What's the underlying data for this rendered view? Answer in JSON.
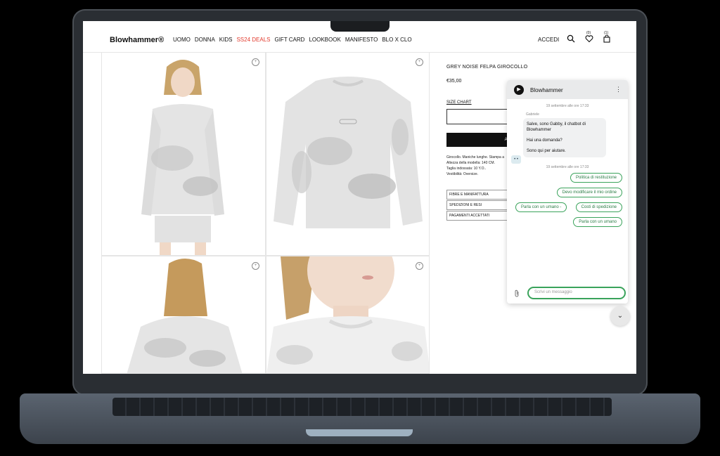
{
  "header": {
    "brand": "Blowhammer®",
    "nav": [
      "UOMO",
      "DONNA",
      "KIDS",
      "SS24 DEALS",
      "GIFT CARD",
      "LOOKBOOK",
      "MANIFESTO",
      "BLO X CLO"
    ],
    "login": "ACCEDI",
    "wishlist_count": "(0)",
    "cart_count": "(1)"
  },
  "product": {
    "title": "GREY NOISE FELPA GIROCOLLO",
    "price": "€35,00",
    "size_chart": "SIZE CHART",
    "add_button_visible": "Ad",
    "description": [
      "Girocollo. Maniche lunghe. Stampa a",
      "Altezza della modella: 140 CM.",
      "Taglia indossata: 10 Y.O..",
      "Vestibilità: Oversize."
    ],
    "accordions": [
      "FIBRE E MANIFATTURA",
      "SPEDIZIONI E RESI",
      "PAGAMENTI ACCETTATI"
    ]
  },
  "chat": {
    "name": "Blowhammer",
    "timestamp1": "19 settembre alle ore 17:33",
    "sender": "Gabriele",
    "messages": [
      "Salve, sono Gabby, il chatbot di Blowhammer",
      "Hai una domanda?",
      "Sono qui per aiutare."
    ],
    "timestamp2": "19 settembre alle ore 17:33",
    "quick_replies": [
      "Politica di restituzione",
      "Devo modificare il mio ordine",
      "Parla con un umano -",
      "Costi di spedizione",
      "Parla con un umano"
    ],
    "input_placeholder": "Scrivi un messaggio"
  },
  "colors": {
    "deal_red": "#e23b2e",
    "chat_green": "#3aa35b",
    "button_black": "#111111"
  },
  "icons": [
    "search-icon",
    "heart-icon",
    "bag-icon",
    "zoom-icon",
    "attach-icon",
    "chevron-down-icon",
    "menu-dots-icon"
  ]
}
